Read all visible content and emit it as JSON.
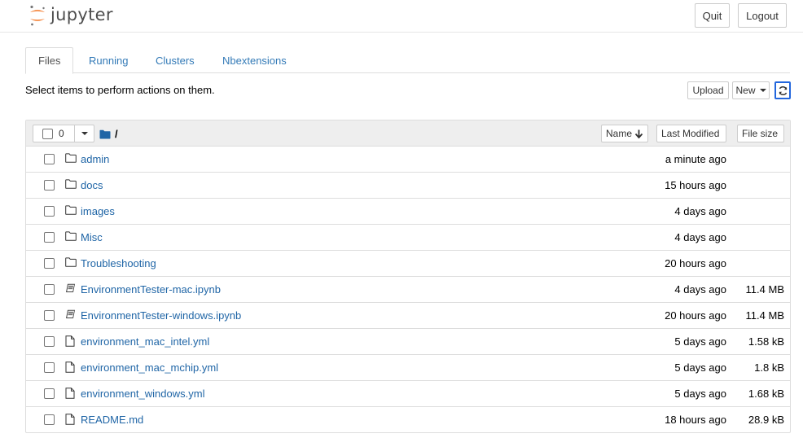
{
  "header": {
    "logo_text": "jupyter",
    "quit_label": "Quit",
    "logout_label": "Logout"
  },
  "tabs": [
    {
      "label": "Files",
      "active": true
    },
    {
      "label": "Running",
      "active": false
    },
    {
      "label": "Clusters",
      "active": false
    },
    {
      "label": "Nbextensions",
      "active": false
    }
  ],
  "toolbar": {
    "hint": "Select items to perform actions on them.",
    "upload_label": "Upload",
    "new_label": "New"
  },
  "list_header": {
    "selected_count": "0",
    "path": "/",
    "sort_name_label": "Name",
    "sort_modified_label": "Last Modified",
    "sort_size_label": "File size"
  },
  "files": [
    {
      "name": "admin",
      "type": "folder",
      "modified": "a minute ago",
      "size": ""
    },
    {
      "name": "docs",
      "type": "folder",
      "modified": "15 hours ago",
      "size": ""
    },
    {
      "name": "images",
      "type": "folder",
      "modified": "4 days ago",
      "size": ""
    },
    {
      "name": "Misc",
      "type": "folder",
      "modified": "4 days ago",
      "size": ""
    },
    {
      "name": "Troubleshooting",
      "type": "folder",
      "modified": "20 hours ago",
      "size": ""
    },
    {
      "name": "EnvironmentTester-mac.ipynb",
      "type": "notebook",
      "modified": "4 days ago",
      "size": "11.4 MB"
    },
    {
      "name": "EnvironmentTester-windows.ipynb",
      "type": "notebook",
      "modified": "20 hours ago",
      "size": "11.4 MB"
    },
    {
      "name": "environment_mac_intel.yml",
      "type": "file",
      "modified": "5 days ago",
      "size": "1.58 kB"
    },
    {
      "name": "environment_mac_mchip.yml",
      "type": "file",
      "modified": "5 days ago",
      "size": "1.8 kB"
    },
    {
      "name": "environment_windows.yml",
      "type": "file",
      "modified": "5 days ago",
      "size": "1.68 kB"
    },
    {
      "name": "README.md",
      "type": "file",
      "modified": "18 hours ago",
      "size": "28.9 kB"
    }
  ],
  "colors": {
    "link": "#1f65a6",
    "jupyter_orange": "#f37726",
    "refresh_border": "#2266dd"
  }
}
